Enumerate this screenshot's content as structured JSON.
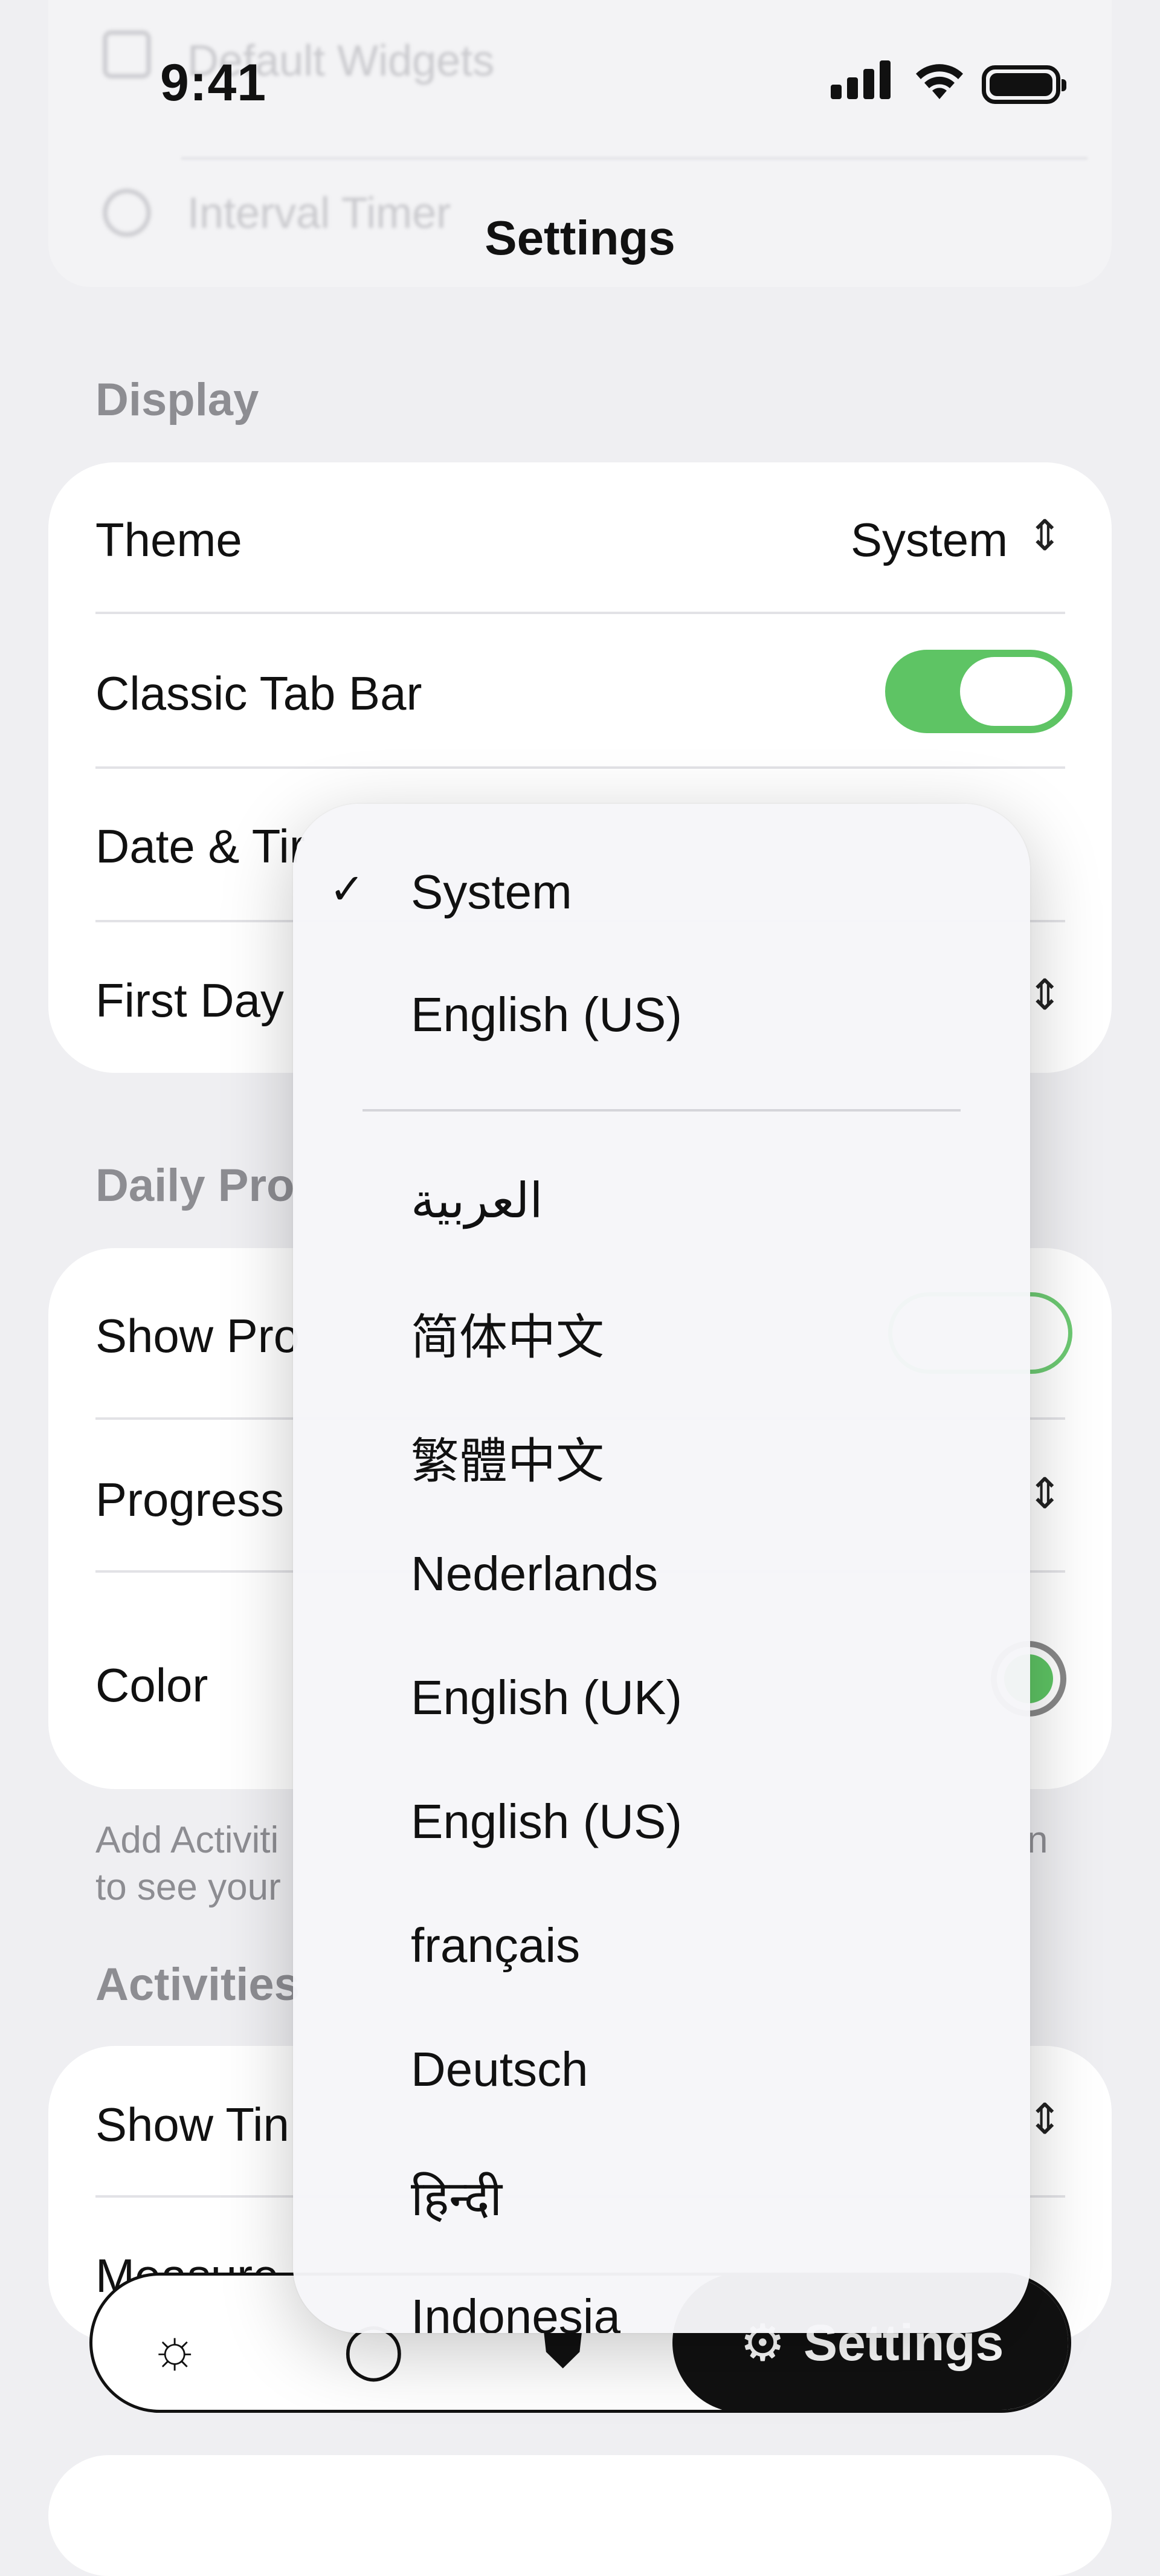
{
  "background_ghost": {
    "row1": "Default Widgets",
    "row2": "Interval Timer"
  },
  "status_bar": {
    "time": "9:41"
  },
  "page_title": "Settings",
  "display": {
    "section_label": "Display",
    "theme_label": "Theme",
    "theme_value": "System",
    "classic_tab_bar_label": "Classic Tab Bar",
    "classic_tab_bar_on": true,
    "date_time_label": "Date & Tir",
    "first_day_label": "First Day"
  },
  "daily_progress": {
    "section_label": "Daily Pro",
    "show_label": "Show Pro",
    "progress_label": "Progress",
    "color_label": "Color",
    "footnote_line1": "Add Activiti",
    "footnote_line1_tail": "n",
    "footnote_line2": "to see your"
  },
  "activities": {
    "section_label": "Activities",
    "show_time_label": "Show Tin",
    "measure_label": "Measure"
  },
  "tabbar": {
    "active_label": "Settings",
    "icons": [
      "sun-icon",
      "circle-icon",
      "shield-icon",
      "gear-icon"
    ]
  },
  "language_menu": {
    "selected_index": 0,
    "top_items": [
      "System",
      "English (US)"
    ],
    "items": [
      "العربية",
      "简体中文",
      "繁體中文",
      "Nederlands",
      "English (UK)",
      "English (US)",
      "français",
      "Deutsch",
      "हिन्दी",
      "Indonesia"
    ]
  },
  "colors": {
    "accent_green": "#5ec464",
    "background": "#efeff2",
    "card": "#ffffff",
    "secondary_text": "#8d8d92"
  }
}
